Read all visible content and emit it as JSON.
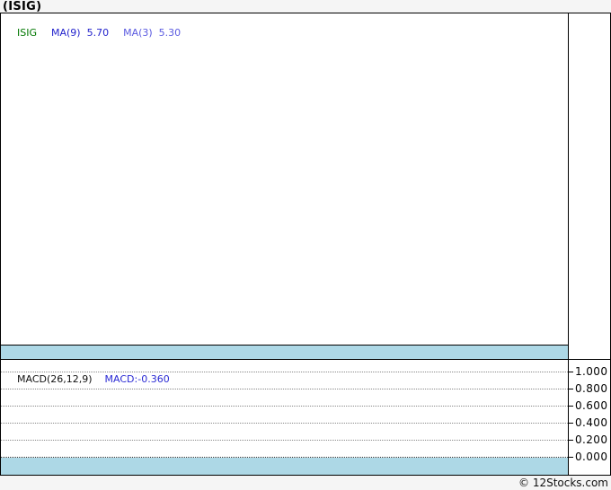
{
  "header": {
    "title": "(ISIG)"
  },
  "footer": {
    "copyright": "© 12Stocks.com"
  },
  "colors": {
    "band_blue": "#ADD8E6",
    "symbol_green": "#007700",
    "ma9_blue": "#2323cc",
    "ma3_violet": "#5a5ae0",
    "macd_label_black": "#111111",
    "macd_value_blue": "#2a2ad4",
    "frame_border": "#000000",
    "page_background": "#f5f5f5"
  },
  "chart_data": [
    {
      "type": "line",
      "panel": "price",
      "title": "(ISIG)",
      "legend": [
        {
          "text": "ISIG",
          "color": "#007700"
        },
        {
          "text": "MA(9)  5.70",
          "color": "#2323cc"
        },
        {
          "text": "MA(3)  5.30",
          "color": "#5a5ae0"
        }
      ],
      "series": [
        {
          "name": "ISIG",
          "values": []
        },
        {
          "name": "MA(9)",
          "last_value": 5.7,
          "values": []
        },
        {
          "name": "MA(3)",
          "last_value": 5.3,
          "values": []
        }
      ],
      "legend_position": "top-left",
      "note": "plot area empty - no price data rendered"
    },
    {
      "type": "line",
      "panel": "macd",
      "legend": [
        {
          "text": "MACD(26,12,9)",
          "color": "#111111"
        },
        {
          "text": "MACD:-0.360",
          "color": "#2a2ad4"
        }
      ],
      "series": [
        {
          "name": "MACD",
          "last_value": -0.36,
          "values": []
        }
      ],
      "ylim": [
        0.0,
        1.0
      ],
      "ytick_labels": [
        "1.000",
        "0.800",
        "0.600",
        "0.400",
        "0.200",
        "0.000"
      ],
      "grid": "dotted horizontal lines",
      "legend_position": "top-left",
      "note": "no MACD line visible; last value -0.360 is below displayed axis range"
    }
  ]
}
